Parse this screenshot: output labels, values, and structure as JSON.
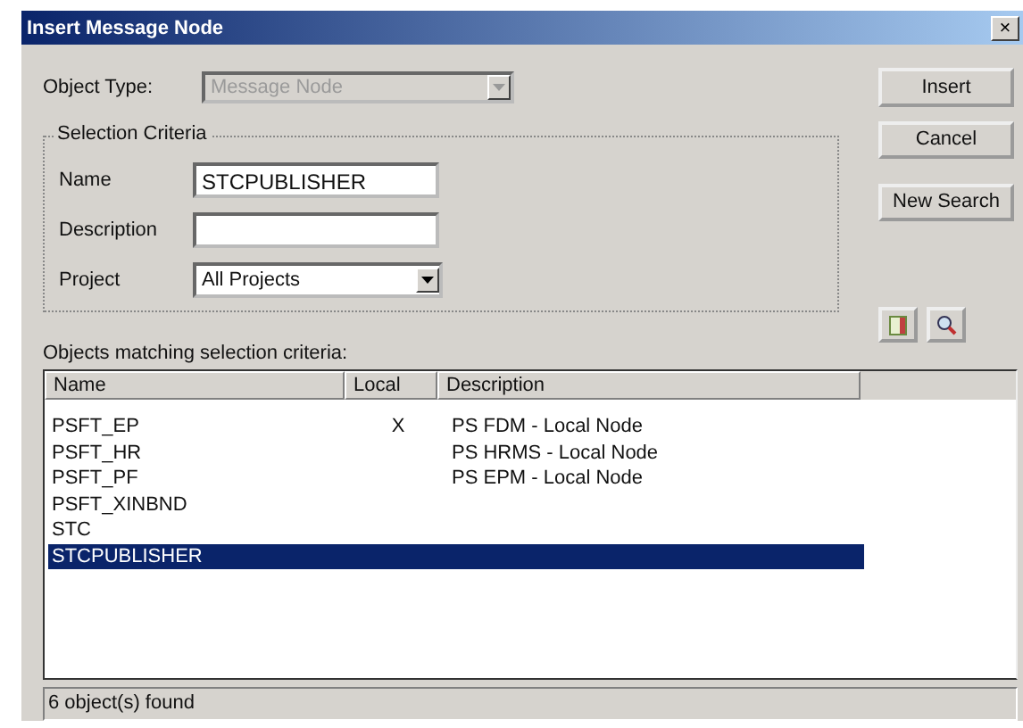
{
  "window": {
    "title": "Insert Message Node",
    "close": "×"
  },
  "object_type": {
    "label": "Object Type:",
    "value": "Message Node",
    "disabled": true
  },
  "selection_criteria": {
    "title": "Selection Criteria",
    "name": {
      "label": "Name",
      "value": "STCPUBLISHER"
    },
    "description": {
      "label": "Description"
    },
    "project": {
      "label": "Project",
      "value": "All Projects"
    }
  },
  "buttons": [
    "Insert",
    "Cancel",
    "New Search"
  ],
  "results": {
    "label": "Objects matching selection criteria:",
    "columns": [
      "Name",
      "Local",
      "Description"
    ],
    "rows": [
      {
        "name": "PSFT_EP",
        "local": "X",
        "description": "PS FDM - Local Node",
        "selected": false
      },
      {
        "name": "PSFT_HR",
        "local": "",
        "description": "PS HRMS - Local Node",
        "selected": false
      },
      {
        "name": "PSFT_PF",
        "local": "",
        "description": "PS EPM - Local Node",
        "selected": false
      },
      {
        "name": "PSFT_XINBND",
        "local": "",
        "description": "",
        "selected": false
      },
      {
        "name": "STC",
        "local": "",
        "description": "",
        "selected": false
      },
      {
        "name": "STCPUBLISHER",
        "local": "",
        "description": "",
        "selected": true
      }
    ]
  },
  "status_bar": "6 object(s) found"
}
